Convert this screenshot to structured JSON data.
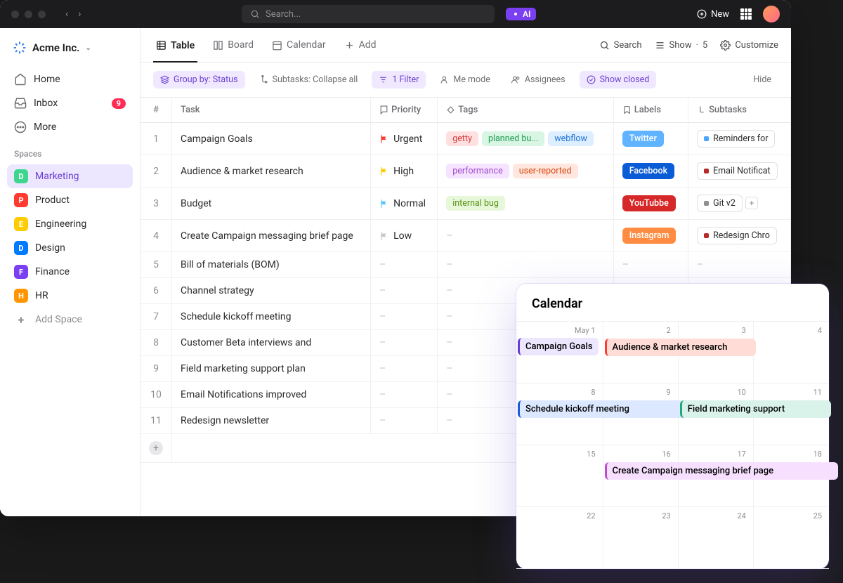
{
  "titlebar": {
    "search_placeholder": "Search...",
    "ai_label": "AI",
    "new_label": "New"
  },
  "workspace": {
    "name": "Acme Inc."
  },
  "side_nav": [
    {
      "label": "Home",
      "icon": "home"
    },
    {
      "label": "Inbox",
      "icon": "inbox",
      "badge": "9"
    },
    {
      "label": "More",
      "icon": "more"
    }
  ],
  "spaces_label": "Spaces",
  "spaces": [
    {
      "letter": "D",
      "label": "Marketing",
      "color": "#3dd68c",
      "active": true
    },
    {
      "letter": "P",
      "label": "Product",
      "color": "#ff3b30"
    },
    {
      "letter": "E",
      "label": "Engineering",
      "color": "#ffcc00"
    },
    {
      "letter": "D",
      "label": "Design",
      "color": "#007aff"
    },
    {
      "letter": "F",
      "label": "Finance",
      "color": "#7b3ff2"
    },
    {
      "letter": "H",
      "label": "HR",
      "color": "#ff9500"
    }
  ],
  "add_space_label": "Add Space",
  "view_tabs": {
    "items": [
      "Table",
      "Board",
      "Calendar",
      "Add"
    ],
    "right": {
      "search": "Search",
      "show": "Show",
      "show_count": "5",
      "customize": "Customize"
    }
  },
  "filters": {
    "group_by": "Group by: Status",
    "subtasks": "Subtasks: Collapse all",
    "filter": "1 Filter",
    "me_mode": "Me mode",
    "assignees": "Assignees",
    "show_closed": "Show closed",
    "hide": "Hide"
  },
  "columns": [
    "#",
    "Task",
    "Priority",
    "Tags",
    "Labels",
    "Subtasks"
  ],
  "rows": [
    {
      "n": "1",
      "task": "Campaign Goals",
      "priority": {
        "text": "Urgent",
        "flag": "red"
      },
      "tags": [
        {
          "text": "getty",
          "bg": "#ffe0e0",
          "fg": "#d63a3a"
        },
        {
          "text": "planned bu...",
          "bg": "#d9f5e3",
          "fg": "#1f9d55"
        },
        {
          "text": "webflow",
          "bg": "#dceeff",
          "fg": "#1e73d6"
        }
      ],
      "label": {
        "text": "Twitter",
        "bg": "#5fb3ff",
        "fg": "#fff"
      },
      "subtask": {
        "text": "Reminders for",
        "dot": "#4aa3ff"
      }
    },
    {
      "n": "2",
      "task": "Audience & market research",
      "priority": {
        "text": "High",
        "flag": "yellow"
      },
      "tags": [
        {
          "text": "performance",
          "bg": "#f5e3ff",
          "fg": "#a04acc"
        },
        {
          "text": "user-reported",
          "bg": "#ffe7df",
          "fg": "#d9480f"
        }
      ],
      "label": {
        "text": "Facebook",
        "bg": "#0a5bd6",
        "fg": "#fff"
      },
      "subtask": {
        "text": "Email Notificat",
        "dot": "#b52a2a"
      }
    },
    {
      "n": "3",
      "task": "Budget",
      "priority": {
        "text": "Normal",
        "flag": "blue"
      },
      "tags": [
        {
          "text": "internal bug",
          "bg": "#e7f7d9",
          "fg": "#5a9216"
        }
      ],
      "label": {
        "text": "YouTubbe",
        "bg": "#d62828",
        "fg": "#fff"
      },
      "subtask": {
        "text": "Git v2",
        "dot": "#8e8e93",
        "plus": true
      }
    },
    {
      "n": "4",
      "task": "Create Campaign messaging brief page",
      "priority": {
        "text": "Low",
        "flag": "grey"
      },
      "tags": [],
      "label": {
        "text": "Instagram",
        "bg": "#ff8c42",
        "fg": "#fff"
      },
      "subtask": {
        "text": "Redesign Chro",
        "dot": "#b52a2a"
      }
    },
    {
      "n": "5",
      "task": "Bill of materials (BOM)"
    },
    {
      "n": "6",
      "task": "Channel strategy"
    },
    {
      "n": "7",
      "task": "Schedule kickoff meeting"
    },
    {
      "n": "8",
      "task": "Customer Beta interviews and"
    },
    {
      "n": "9",
      "task": "Field marketing support plan"
    },
    {
      "n": "10",
      "task": "Email Notifications improved"
    },
    {
      "n": "11",
      "task": "Redesign newsletter"
    }
  ],
  "calendar": {
    "title": "Calendar",
    "dates": [
      "May 1",
      "2",
      "3",
      "4",
      "8",
      "9",
      "10",
      "11",
      "15",
      "16",
      "17",
      "18",
      "22",
      "23",
      "24",
      "25"
    ],
    "events": [
      {
        "cell": 0,
        "text": "Campaign Goals",
        "bg": "#ece6ff",
        "border": "#6b3fd4",
        "span": 1
      },
      {
        "cell": 1,
        "text": "Audience & market research",
        "bg": "#ffdcd6",
        "border": "#ff3b30",
        "span": 2
      },
      {
        "cell": 4,
        "text": "Schedule kickoff meeting",
        "bg": "#dce8ff",
        "border": "#1e5bd6",
        "span": 2
      },
      {
        "cell": 6,
        "text": "Field marketing support",
        "bg": "#d9f2ea",
        "border": "#1fa97a",
        "span": 2
      },
      {
        "cell": 9,
        "text": "Create Campaign messaging brief page",
        "bg": "#f7e0ff",
        "border": "#c04acc",
        "span": 3
      }
    ]
  }
}
